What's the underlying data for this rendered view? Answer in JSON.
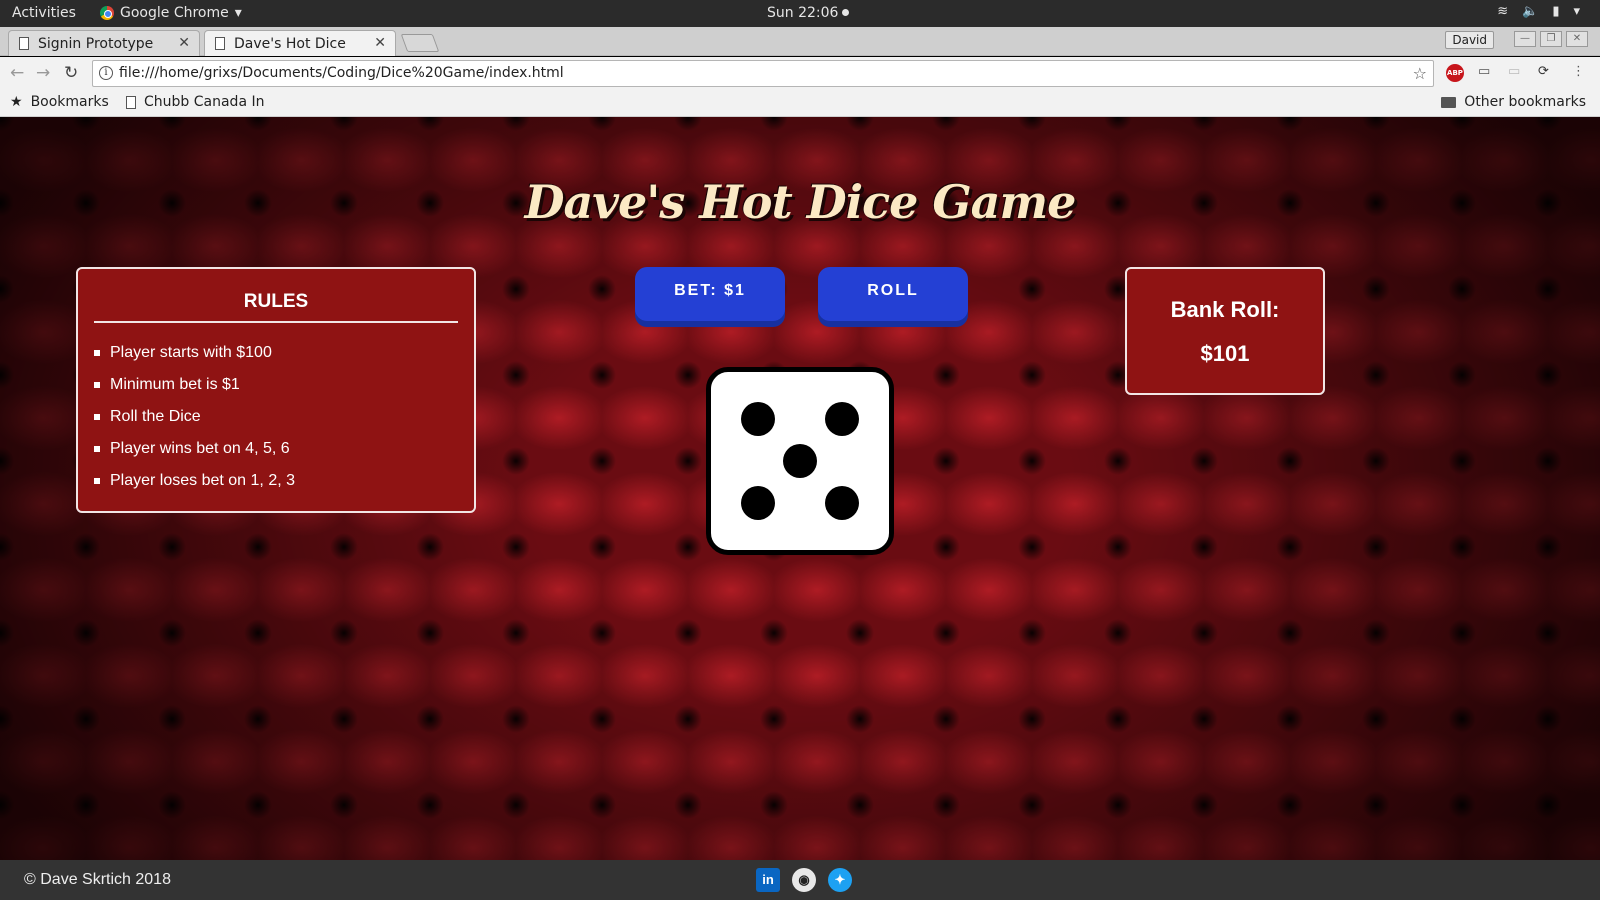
{
  "os": {
    "activities": "Activities",
    "app_name": "Google Chrome",
    "clock": "Sun 22:06"
  },
  "browser": {
    "tabs": [
      {
        "title": "Signin Prototype"
      },
      {
        "title": "Dave's Hot Dice"
      }
    ],
    "user": "David",
    "url": "file:///home/grixs/Documents/Coding/Dice%20Game/index.html",
    "bookmarks": {
      "apps": "Bookmarks",
      "item": "Chubb Canada In",
      "other": "Other bookmarks"
    }
  },
  "game": {
    "title": "Dave's Hot Dice Game",
    "rules": {
      "heading": "RULES",
      "items": [
        "Player starts with $100",
        "Minimum bet is $1",
        "Roll the Dice",
        "Player wins bet on 4, 5, 6",
        "Player loses bet on 1, 2, 3"
      ]
    },
    "bet_button": "BET: $1",
    "roll_button": "ROLL",
    "die_value": 5,
    "bank": {
      "label": "Bank Roll:",
      "amount": "$101"
    }
  },
  "footer": {
    "copyright": "© Dave Skrtich 2018",
    "social": [
      "linkedin-icon",
      "github-icon",
      "twitter-icon"
    ]
  },
  "colors": {
    "panel": "#8f1313",
    "button": "#2440d4",
    "title": "#fbe9c4"
  }
}
